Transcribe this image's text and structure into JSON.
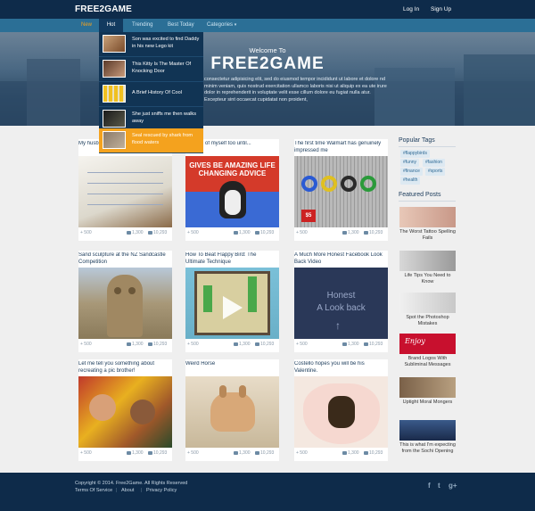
{
  "header": {
    "logo": "FREE2GAME",
    "login": "Log In",
    "signup": "Sign Up"
  },
  "nav": {
    "new": "New",
    "hot": "Hot",
    "trending": "Trending",
    "best_today": "Best Today",
    "categories": "Categories",
    "search_icon": "search-icon"
  },
  "hero": {
    "welcome": "Welcome To",
    "title": "FREE2GAME",
    "text": "consectetur adipisicing elit, sed do eiusmod tempor incididunt ut labore et dolore nd minim veniam, quis nostrud exercitation ullamco laboris nisi ut aliquip ex ea ute irure dolor in reprehenderit in voluptate velit esse cillum dolore eu fugiat nulla atur. Excepteur sint occaecat cupidatat non proident,"
  },
  "dropdown": [
    {
      "text": "Son was excited to find Daddy in his new Lego kit"
    },
    {
      "text": "This Kitty Is The Master Of Knocking Door"
    },
    {
      "text": "A Brief History Of Cool"
    },
    {
      "text": "She just sniffs me then walks away"
    },
    {
      "text": "Seal rescued by shark from flood waters"
    }
  ],
  "cards": [
    {
      "title": "My husb",
      "likes": "+ 500",
      "comments": "1,300",
      "views": "10,293"
    },
    {
      "title": "o proud of myself too until...",
      "likes": "+ 500",
      "comments": "1,300",
      "views": "10,293"
    },
    {
      "title": "The first time Walmart has genuinely impressed me",
      "likes": "+ 500",
      "comments": "1,300",
      "views": "10,293"
    },
    {
      "title": "Sand sculpture at the NZ Sandcastle Competition",
      "likes": "+ 500",
      "comments": "1,300",
      "views": "10,293"
    },
    {
      "title": "How To Beat Flappy Bird: The Ultimate Technique",
      "likes": "+ 500",
      "comments": "1,300",
      "views": "10,293"
    },
    {
      "title": "A Much More Honest Facebook Look Back Video",
      "likes": "+ 500",
      "comments": "1,300",
      "views": "10,293"
    },
    {
      "title": "Let me tell you something about recreating a pic brother!",
      "likes": "+ 500",
      "comments": "1,300",
      "views": "10,293"
    },
    {
      "title": "Weird Horse",
      "likes": "+ 500",
      "comments": "1,300",
      "views": "10,293"
    },
    {
      "title": "Costello hopes you will be his Valentine.",
      "likes": "+ 500",
      "comments": "1,300",
      "views": "10,293"
    }
  ],
  "meme": {
    "top": "GIVES BE AMAZING LIFE CHANGING ADVICE",
    "bottom": "",
    "walmart_price": "$5"
  },
  "honest": {
    "line1": "Honest",
    "line2": "A Look back"
  },
  "sidebar": {
    "popular_tags_title": "Popular Tags",
    "tags": [
      "#flappybirds",
      "#funny",
      "#fashion",
      "#finance",
      "#sports",
      "#health"
    ],
    "featured_title": "Featured Posts",
    "featured": [
      {
        "caption": "The Worst Tattoo Spelling Fails"
      },
      {
        "caption": "Life Tips You Need to Know"
      },
      {
        "caption": "Spot the Photoshop Mistakes"
      },
      {
        "caption": "Brand Logos With Subliminal Messages"
      },
      {
        "caption": "Uptight Moral Mongers"
      },
      {
        "caption": "This is what I'm expecting from the Sochi Opening"
      }
    ],
    "coke_text": "Enjoy"
  },
  "footer": {
    "copyright": "Copyright © 2014. Free2Game. All Rights Reserved",
    "terms": "Terms Of Service",
    "about": "About",
    "privacy": "Privacy Policy",
    "facebook": "f",
    "twitter": "t",
    "gplus": "g+"
  },
  "colors": {
    "brand_dark": "#0e2b4a",
    "nav_blue": "#2b6f96",
    "accent_orange": "#f4a21e"
  }
}
